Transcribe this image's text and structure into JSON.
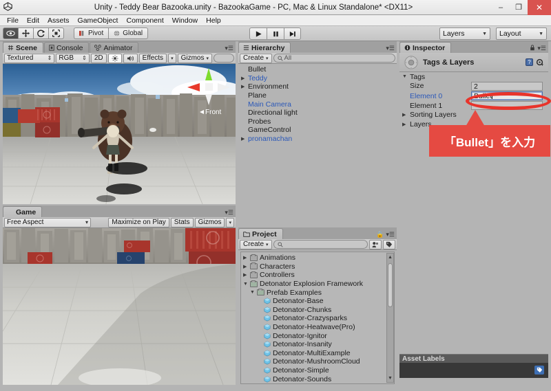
{
  "window": {
    "title": "Unity - Teddy Bear Bazooka.unity - BazookaGame - PC, Mac & Linux Standalone* <DX11>",
    "unity_icon": "unity-logo-icon",
    "minimize_label": "–",
    "restore_label": "❐",
    "close_label": "✕"
  },
  "menubar": {
    "items": [
      {
        "label": "File"
      },
      {
        "label": "Edit"
      },
      {
        "label": "Assets"
      },
      {
        "label": "GameObject"
      },
      {
        "label": "Component"
      },
      {
        "label": "Window"
      },
      {
        "label": "Help"
      }
    ]
  },
  "toolbar": {
    "tools": [
      {
        "name": "hand-tool",
        "icon": "hand-icon",
        "active": true
      },
      {
        "name": "move-tool",
        "icon": "move-arrows-icon",
        "active": false
      },
      {
        "name": "rotate-tool",
        "icon": "rotate-icon",
        "active": false
      },
      {
        "name": "scale-tool",
        "icon": "scale-icon",
        "active": false
      }
    ],
    "pivot_label": "Pivot",
    "global_label": "Global",
    "play_label": "▶",
    "pause_label": "❚❚",
    "step_label": "▶❙",
    "layers_label": "Layers",
    "layout_label": "Layout"
  },
  "scene_panel": {
    "tabs": [
      {
        "label": "Scene",
        "icon": "scene-grid-icon",
        "active": true
      },
      {
        "label": "Console",
        "icon": "console-icon",
        "active": false
      },
      {
        "label": "Animator",
        "icon": "animator-icon",
        "active": false
      }
    ],
    "draw_mode": "Textured",
    "color_mode": "RGB",
    "two_d_label": "2D",
    "light_icon": "sun-icon",
    "audio_icon": "speaker-icon",
    "effects_label": "Effects",
    "gizmos_label": "Gizmos",
    "search_placeholder": "",
    "gizmo_front_label": "Front"
  },
  "game_panel": {
    "tab_label": "Game",
    "tab_icon": "game-pad-icon",
    "aspect_label": "Free Aspect",
    "maximize_label": "Maximize on Play",
    "stats_label": "Stats",
    "gizmos_label": "Gizmos"
  },
  "hierarchy_panel": {
    "tab_label": "Hierarchy",
    "tab_icon": "hierarchy-list-icon",
    "create_label": "Create",
    "search_placeholder": "All",
    "items": [
      {
        "label": "Bullet",
        "expandable": false,
        "blue": false,
        "indent": 0
      },
      {
        "label": "Teddy",
        "expandable": true,
        "blue": true,
        "indent": 0
      },
      {
        "label": "Environment",
        "expandable": true,
        "blue": false,
        "indent": 0
      },
      {
        "label": "Plane",
        "expandable": false,
        "blue": false,
        "indent": 0
      },
      {
        "label": "Main Camera",
        "expandable": false,
        "blue": true,
        "indent": 0
      },
      {
        "label": "Directional light",
        "expandable": false,
        "blue": false,
        "indent": 0
      },
      {
        "label": "Probes",
        "expandable": false,
        "blue": false,
        "indent": 0
      },
      {
        "label": "GameControl",
        "expandable": false,
        "blue": false,
        "indent": 0
      },
      {
        "label": "pronamachan",
        "expandable": true,
        "blue": true,
        "indent": 0
      }
    ]
  },
  "project_panel": {
    "tab_label": "Project",
    "tab_icon": "folder-icon",
    "create_label": "Create",
    "search_placeholder": "",
    "items": [
      {
        "label": "Animations",
        "type": "folder",
        "expandable": true,
        "expanded": false,
        "indent": 0
      },
      {
        "label": "Characters",
        "type": "folder",
        "expandable": true,
        "expanded": false,
        "indent": 0
      },
      {
        "label": "Controllers",
        "type": "folder",
        "expandable": true,
        "expanded": false,
        "indent": 0
      },
      {
        "label": "Detonator Explosion Framework",
        "type": "folder",
        "expandable": true,
        "expanded": true,
        "indent": 0
      },
      {
        "label": "Prefab Examples",
        "type": "folder",
        "expandable": true,
        "expanded": true,
        "indent": 1
      },
      {
        "label": "Detonator-Base",
        "type": "prefab",
        "expandable": false,
        "expanded": false,
        "indent": 2
      },
      {
        "label": "Detonator-Chunks",
        "type": "prefab",
        "expandable": false,
        "expanded": false,
        "indent": 2
      },
      {
        "label": "Detonator-Crazysparks",
        "type": "prefab",
        "expandable": false,
        "expanded": false,
        "indent": 2
      },
      {
        "label": "Detonator-Heatwave(Pro)",
        "type": "prefab",
        "expandable": false,
        "expanded": false,
        "indent": 2
      },
      {
        "label": "Detonator-Ignitor",
        "type": "prefab",
        "expandable": false,
        "expanded": false,
        "indent": 2
      },
      {
        "label": "Detonator-Insanity",
        "type": "prefab",
        "expandable": false,
        "expanded": false,
        "indent": 2
      },
      {
        "label": "Detonator-MultiExample",
        "type": "prefab",
        "expandable": false,
        "expanded": false,
        "indent": 2
      },
      {
        "label": "Detonator-MushroomCloud",
        "type": "prefab",
        "expandable": false,
        "expanded": false,
        "indent": 2
      },
      {
        "label": "Detonator-Simple",
        "type": "prefab",
        "expandable": false,
        "expanded": false,
        "indent": 2
      },
      {
        "label": "Detonator-Sounds",
        "type": "prefab",
        "expandable": false,
        "expanded": false,
        "indent": 2
      }
    ]
  },
  "inspector_panel": {
    "tab_label": "Inspector",
    "tab_icon": "info-circle-icon",
    "lock_icon": "lock-icon",
    "menu_icon": "hamburger-icon",
    "header_title": "Tags & Layers",
    "header_icon": "gear-asset-icon",
    "help_icon": "question-mark-icon",
    "settings_icon": "gear-icon",
    "sections": [
      {
        "label": "Tags",
        "expanded": true
      },
      {
        "label": "Sorting Layers",
        "expanded": false
      },
      {
        "label": "Layers",
        "expanded": false
      }
    ],
    "tags": {
      "size_label": "Size",
      "size_value": "2",
      "elements": [
        {
          "label": "Element 0",
          "value": "Bullet",
          "editing": true
        },
        {
          "label": "Element 1",
          "value": "",
          "editing": false
        }
      ]
    }
  },
  "asset_labels": {
    "header": "Asset Labels",
    "tag_icon": "label-tag-icon"
  },
  "annotation": {
    "text": "「Bullet」を入力",
    "color": "#e54a42",
    "highlight_color": "#e8342b"
  },
  "colors": {
    "chrome": "#b4b4b4",
    "toolbar": "#c8c8c8",
    "link_blue": "#2b58b8",
    "accent_red": "#e54a42",
    "panel_dark": "#383838"
  }
}
